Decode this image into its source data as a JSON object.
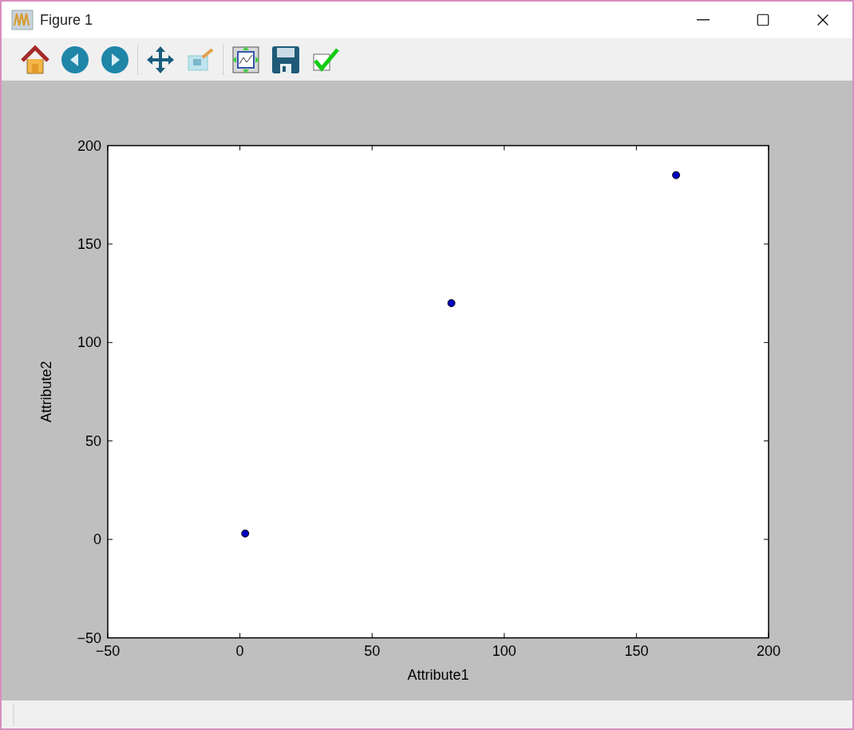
{
  "window": {
    "title": "Figure 1"
  },
  "figure": {
    "chart_data": {
      "type": "scatter",
      "xlabel": "Attribute1",
      "ylabel": "Attribute2",
      "series": [
        {
          "color": "#0000bf",
          "x": [
            2,
            80,
            165
          ],
          "values": [
            3,
            120,
            185
          ]
        }
      ],
      "xlim": [
        -50,
        200
      ],
      "ylim": [
        -50,
        200
      ],
      "xticks": [
        {
          "value": -50,
          "label": "−50"
        },
        0,
        50,
        100,
        150,
        200
      ],
      "yticks": [
        {
          "value": -50,
          "label": "−50"
        },
        0,
        50,
        100,
        150,
        200
      ]
    }
  }
}
